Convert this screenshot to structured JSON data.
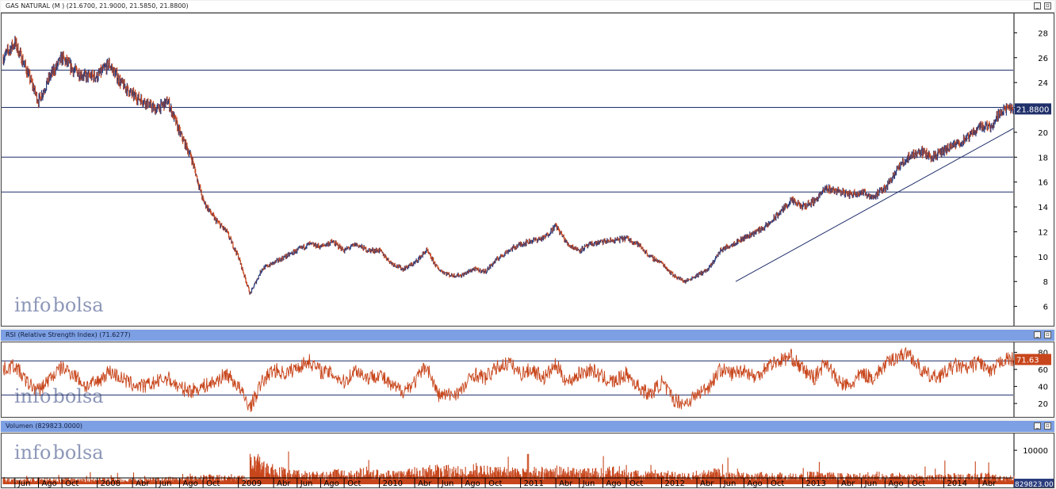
{
  "watermark": {
    "part1": "info",
    "part2": "bolsa"
  },
  "panels": {
    "price": {
      "title": "GAS NATURAL (M ) (21.6700, 21.9000, 21.5850, 21.8800)",
      "last_label": "21.8800"
    },
    "rsi": {
      "title": "RSI (Relative Strength Index) (71.6277)",
      "last_label": "71.63"
    },
    "volume": {
      "title": "Volumen (829823.0000)",
      "last_label": "829823.0000"
    }
  },
  "window_buttons": {
    "minimize": "_",
    "restore": "▫"
  },
  "colors": {
    "up_bar": "#2a3c7c",
    "down_bar": "#c8461c",
    "rsi_line": "#c8461c",
    "volume": "#c8461c",
    "level_line": "#1f2f6a",
    "trendline": "#1f2f6a",
    "title_blue": "#7d9fe3"
  },
  "chart_data": [
    {
      "type": "line",
      "title": "GAS NATURAL (M ) (21.6700, 21.9000, 21.5850, 21.8800)",
      "xlabel": "",
      "ylabel": "",
      "ylim": [
        4.7,
        29.3
      ],
      "y_ticks": [
        6,
        8,
        10,
        12,
        14,
        16,
        18,
        20,
        22,
        24,
        26,
        28
      ],
      "y_tick_labels": [
        "6",
        "8",
        "10",
        "12",
        "14",
        "16",
        "18",
        "20",
        "22",
        "24",
        "26",
        "28"
      ],
      "horizontal_levels": [
        25.0,
        22.0,
        18.0,
        15.2
      ],
      "trendline": {
        "start": [
          "2012-07",
          8.0
        ],
        "end": [
          "2014-06",
          20.3
        ]
      },
      "last_value": 21.88,
      "series": [
        {
          "x": [
            "2007-05",
            "2007-06",
            "2007-07",
            "2007-08",
            "2007-09",
            "2007-10",
            "2007-11",
            "2007-12",
            "2008-01",
            "2008-02",
            "2008-03",
            "2008-04",
            "2008-05",
            "2008-06",
            "2008-07",
            "2008-08",
            "2008-09",
            "2008-10",
            "2008-11",
            "2008-12",
            "2009-01",
            "2009-02",
            "2009-03",
            "2009-04",
            "2009-05",
            "2009-06",
            "2009-07",
            "2009-08",
            "2009-09",
            "2009-10",
            "2009-11",
            "2009-12",
            "2010-01",
            "2010-02",
            "2010-03",
            "2010-04",
            "2010-05",
            "2010-06",
            "2010-07",
            "2010-08",
            "2010-09",
            "2010-10",
            "2010-11",
            "2010-12",
            "2011-01",
            "2011-02",
            "2011-03",
            "2011-04",
            "2011-05",
            "2011-06",
            "2011-07",
            "2011-08",
            "2011-09",
            "2011-10",
            "2011-11",
            "2011-12",
            "2012-01",
            "2012-02",
            "2012-03",
            "2012-04",
            "2012-05",
            "2012-06",
            "2012-07",
            "2012-08",
            "2012-09",
            "2012-10",
            "2012-11",
            "2012-12",
            "2013-01",
            "2013-02",
            "2013-03",
            "2013-04",
            "2013-05",
            "2013-06",
            "2013-07",
            "2013-08",
            "2013-09",
            "2013-10",
            "2013-11",
            "2013-12",
            "2014-01",
            "2014-02",
            "2014-03",
            "2014-04",
            "2014-05",
            "2014-06"
          ],
          "values": [
            26.0,
            27.2,
            25.0,
            22.5,
            24.5,
            26.0,
            25.0,
            24.5,
            24.5,
            25.5,
            24.0,
            23.0,
            22.5,
            21.8,
            22.5,
            20.0,
            18.0,
            14.5,
            13.0,
            12.0,
            10.0,
            7.0,
            9.0,
            9.5,
            10.0,
            10.5,
            11.0,
            10.8,
            11.2,
            10.5,
            11.0,
            10.5,
            10.5,
            9.5,
            9.0,
            9.5,
            10.5,
            9.0,
            8.5,
            8.5,
            9.0,
            8.8,
            9.8,
            10.5,
            11.0,
            11.3,
            11.5,
            12.5,
            11.0,
            10.5,
            11.0,
            11.2,
            11.3,
            11.5,
            11.0,
            10.0,
            9.5,
            8.5,
            8.0,
            8.5,
            9.0,
            10.5,
            11.0,
            11.5,
            12.0,
            12.5,
            13.5,
            14.5,
            14.0,
            14.5,
            15.5,
            15.3,
            15.0,
            15.2,
            14.8,
            15.5,
            17.0,
            18.0,
            18.5,
            18.0,
            18.5,
            19.0,
            19.5,
            20.5,
            20.5,
            21.88
          ]
        }
      ]
    },
    {
      "type": "line",
      "title": "RSI (Relative Strength Index) (71.6277)",
      "ylim": [
        8,
        88
      ],
      "y_ticks": [
        20,
        40,
        60,
        80
      ],
      "y_tick_labels": [
        "20",
        "40",
        "60",
        "80"
      ],
      "horizontal_levels": [
        30,
        70
      ],
      "last_value": 71.63,
      "series": [
        {
          "x": [
            "2007-05",
            "2007-06",
            "2007-07",
            "2007-08",
            "2007-09",
            "2007-10",
            "2007-11",
            "2007-12",
            "2008-01",
            "2008-02",
            "2008-03",
            "2008-04",
            "2008-05",
            "2008-06",
            "2008-07",
            "2008-08",
            "2008-09",
            "2008-10",
            "2008-11",
            "2008-12",
            "2009-01",
            "2009-02",
            "2009-03",
            "2009-04",
            "2009-05",
            "2009-06",
            "2009-07",
            "2009-08",
            "2009-09",
            "2009-10",
            "2009-11",
            "2009-12",
            "2010-01",
            "2010-02",
            "2010-03",
            "2010-04",
            "2010-05",
            "2010-06",
            "2010-07",
            "2010-08",
            "2010-09",
            "2010-10",
            "2010-11",
            "2010-12",
            "2011-01",
            "2011-02",
            "2011-03",
            "2011-04",
            "2011-05",
            "2011-06",
            "2011-07",
            "2011-08",
            "2011-09",
            "2011-10",
            "2011-11",
            "2011-12",
            "2012-01",
            "2012-02",
            "2012-03",
            "2012-04",
            "2012-05",
            "2012-06",
            "2012-07",
            "2012-08",
            "2012-09",
            "2012-10",
            "2012-11",
            "2012-12",
            "2013-01",
            "2013-02",
            "2013-03",
            "2013-04",
            "2013-05",
            "2013-06",
            "2013-07",
            "2013-08",
            "2013-09",
            "2013-10",
            "2013-11",
            "2013-12",
            "2014-01",
            "2014-02",
            "2014-03",
            "2014-04",
            "2014-05",
            "2014-06"
          ],
          "values": [
            60,
            65,
            45,
            35,
            50,
            62,
            55,
            40,
            45,
            58,
            50,
            42,
            40,
            45,
            50,
            38,
            35,
            40,
            45,
            55,
            40,
            15,
            45,
            60,
            55,
            62,
            70,
            58,
            55,
            45,
            60,
            50,
            55,
            40,
            35,
            45,
            65,
            30,
            30,
            35,
            55,
            50,
            62,
            68,
            55,
            60,
            50,
            65,
            45,
            55,
            60,
            50,
            45,
            55,
            40,
            30,
            45,
            25,
            20,
            30,
            40,
            60,
            55,
            60,
            50,
            65,
            70,
            75,
            60,
            50,
            70,
            45,
            40,
            55,
            50,
            65,
            75,
            80,
            60,
            50,
            55,
            65,
            60,
            70,
            55,
            71.63
          ]
        }
      ]
    },
    {
      "type": "bar",
      "title": "Volumen (829823.0000)",
      "ylim": [
        0,
        14000
      ],
      "y_ticks": [
        10000
      ],
      "y_tick_labels": [
        "10000"
      ],
      "last_value": 829823.0,
      "x": [
        "2007-05",
        "2007-06",
        "2007-07",
        "2007-08",
        "2007-09",
        "2007-10",
        "2007-11",
        "2007-12",
        "2008-01",
        "2008-02",
        "2008-03",
        "2008-04",
        "2008-05",
        "2008-06",
        "2008-07",
        "2008-08",
        "2008-09",
        "2008-10",
        "2008-11",
        "2008-12",
        "2009-01",
        "2009-02",
        "2009-03",
        "2009-04",
        "2009-05",
        "2009-06",
        "2009-07",
        "2009-08",
        "2009-09",
        "2009-10",
        "2009-11",
        "2009-12",
        "2010-01",
        "2010-02",
        "2010-03",
        "2010-04",
        "2010-05",
        "2010-06",
        "2010-07",
        "2010-08",
        "2010-09",
        "2010-10",
        "2010-11",
        "2010-12",
        "2011-01",
        "2011-02",
        "2011-03",
        "2011-04",
        "2011-05",
        "2011-06",
        "2011-07",
        "2011-08",
        "2011-09",
        "2011-10",
        "2011-11",
        "2011-12",
        "2012-01",
        "2012-02",
        "2012-03",
        "2012-04",
        "2012-05",
        "2012-06",
        "2012-07",
        "2012-08",
        "2012-09",
        "2012-10",
        "2012-11",
        "2012-12",
        "2013-01",
        "2013-02",
        "2013-03",
        "2013-04",
        "2013-05",
        "2013-06",
        "2013-07",
        "2013-08",
        "2013-09",
        "2013-10",
        "2013-11",
        "2013-12",
        "2014-01",
        "2014-02",
        "2014-03",
        "2014-04",
        "2014-05",
        "2014-06"
      ],
      "values": [
        1200,
        1100,
        1300,
        1400,
        1200,
        1300,
        1100,
        1200,
        1300,
        1400,
        1300,
        1200,
        1300,
        1400,
        1500,
        1600,
        1800,
        2000,
        1900,
        1700,
        1800,
        6000,
        4500,
        3500,
        3000,
        2800,
        2600,
        2500,
        3000,
        2700,
        3500,
        3000,
        2800,
        2700,
        3200,
        3500,
        4000,
        3800,
        3500,
        3000,
        4200,
        3800,
        3600,
        3400,
        3200,
        3500,
        3300,
        3700,
        3400,
        3200,
        3300,
        3500,
        3000,
        2800,
        2600,
        2500,
        2800,
        2600,
        2500,
        2800,
        3200,
        2700,
        2500,
        2400,
        2600,
        2300,
        2400,
        2200,
        2500,
        2600,
        2400,
        2300,
        2200,
        2400,
        2500,
        2300,
        2200,
        2100,
        2000,
        2100,
        2200,
        2000,
        2100,
        2300,
        2000,
        1900
      ]
    }
  ],
  "x_axis": {
    "labels": [
      "Jun",
      "Ago",
      "Oct",
      "2008",
      "Abr",
      "Jun",
      "Ago",
      "Oct",
      "2009",
      "Abr",
      "Jun",
      "Ago",
      "Oct",
      "2010",
      "Abr",
      "Jun",
      "Ago",
      "Oct",
      "2011",
      "Abr",
      "Jun",
      "Ago",
      "Oct",
      "2012",
      "Abr",
      "Jun",
      "Ago",
      "Oct",
      "2013",
      "Abr",
      "Jun",
      "Ago",
      "Oct",
      "2014",
      "Abr"
    ],
    "label_dates": [
      "2007-06",
      "2007-08",
      "2007-10",
      "2008-01",
      "2008-04",
      "2008-06",
      "2008-08",
      "2008-10",
      "2009-01",
      "2009-04",
      "2009-06",
      "2009-08",
      "2009-10",
      "2010-01",
      "2010-04",
      "2010-06",
      "2010-08",
      "2010-10",
      "2011-01",
      "2011-04",
      "2011-06",
      "2011-08",
      "2011-10",
      "2012-01",
      "2012-04",
      "2012-06",
      "2012-08",
      "2012-10",
      "2013-01",
      "2013-04",
      "2013-06",
      "2013-08",
      "2013-10",
      "2014-01",
      "2014-04"
    ]
  }
}
